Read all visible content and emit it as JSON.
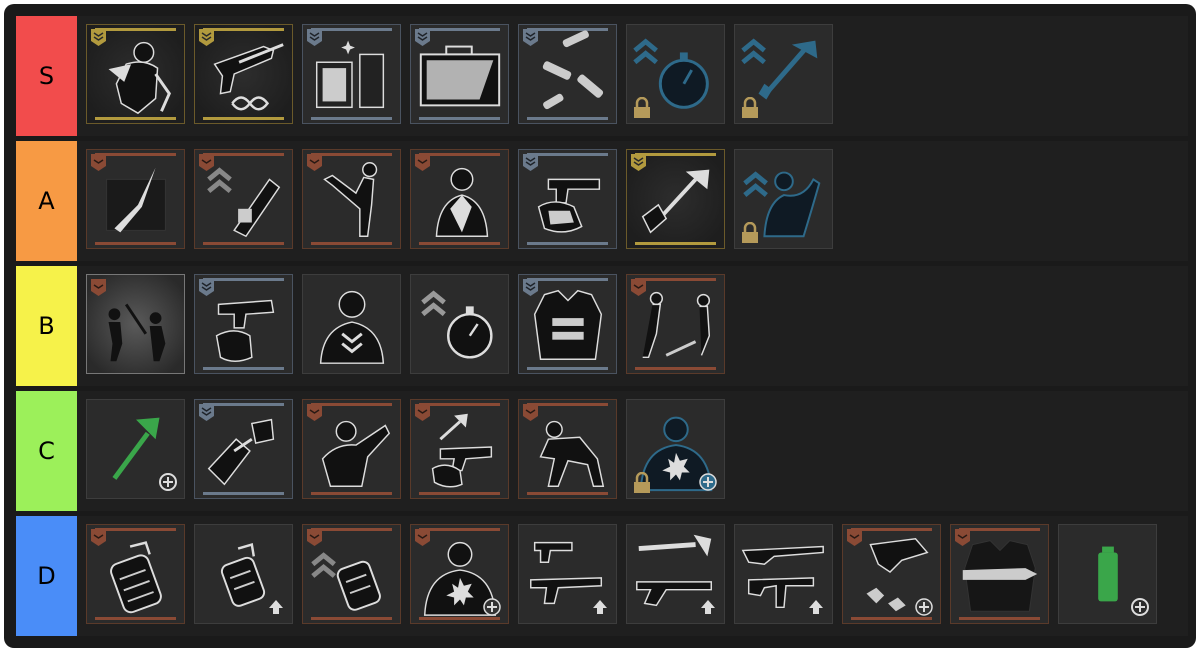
{
  "tiers": [
    {
      "label": "S",
      "color": "#f24c4c"
    },
    {
      "label": "A",
      "color": "#f79a44"
    },
    {
      "label": "B",
      "color": "#f6f24a"
    },
    {
      "label": "C",
      "color": "#9cf05a"
    },
    {
      "label": "D",
      "color": "#4a8df8"
    }
  ],
  "colors": {
    "board_background": "#1a1a1a",
    "row_background": "#1f1f1f",
    "badge_gold": "#b29a3e",
    "badge_copper": "#8a4a35",
    "badge_steel": "#6b7a8c",
    "skill_blue": "#2e6a8a",
    "green_item": "#3aa64a"
  }
}
